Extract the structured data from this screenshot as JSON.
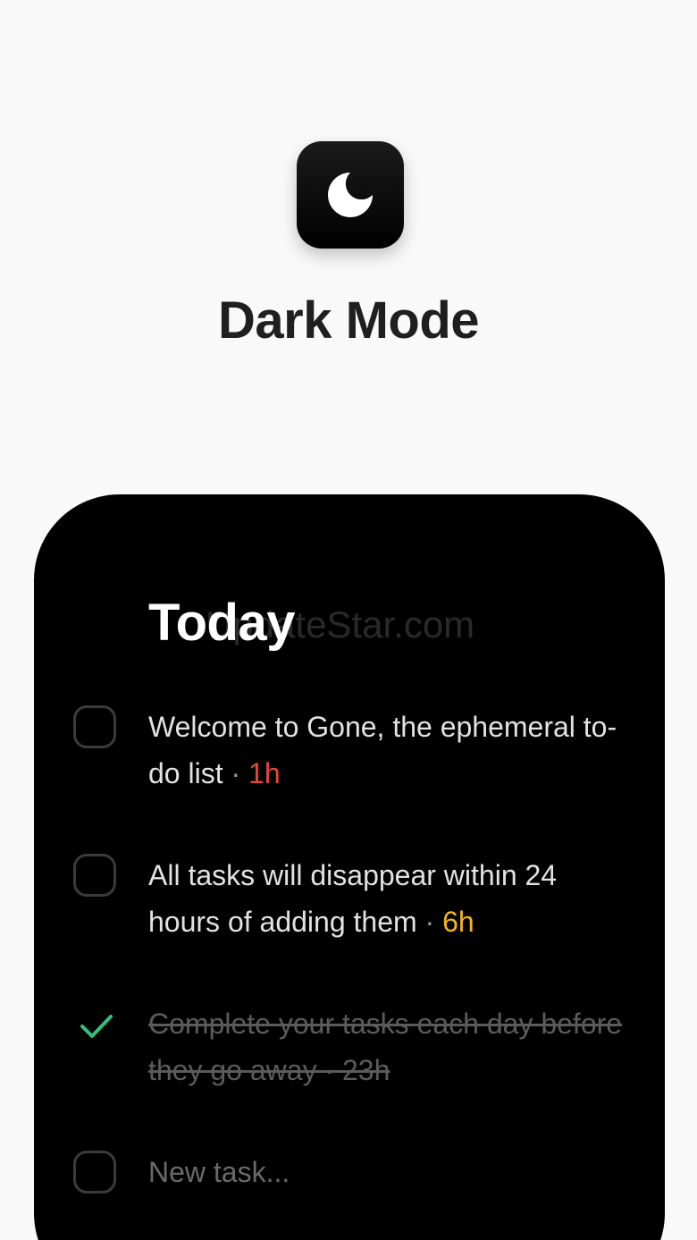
{
  "feature": {
    "icon": "moon-icon",
    "title": "Dark Mode"
  },
  "phone": {
    "section_title": "Today",
    "watermark": "UpdateStar.com",
    "tasks": [
      {
        "text": "Welcome to Gone, the ephemeral to-do list",
        "separator": "·",
        "age": "1h",
        "age_color": "#e5483a",
        "done": false
      },
      {
        "text": "All tasks will disappear within 24 hours of adding them",
        "separator": "·",
        "age": "6h",
        "age_color": "#f3b41f",
        "done": false
      },
      {
        "text": "Complete your tasks each day before they go away",
        "separator": "·",
        "age": "23h",
        "age_color": "#5b5b5b",
        "done": true
      }
    ],
    "new_task_placeholder": "New task..."
  },
  "colors": {
    "background": "#f9f9f9",
    "phone_background": "#000000",
    "check_green": "#2ec27e"
  }
}
